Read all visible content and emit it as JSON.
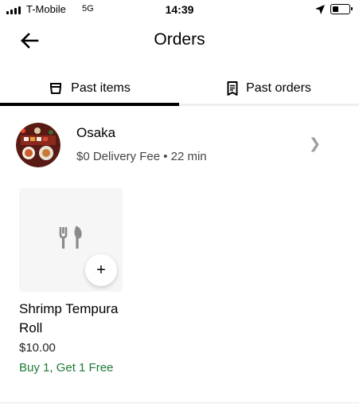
{
  "status_bar": {
    "carrier": "T-Mobile",
    "network": "5G",
    "time": "14:39",
    "battery_level": 0.35,
    "signal_bars": 4
  },
  "header": {
    "title": "Orders",
    "back_icon": "arrow-left-icon"
  },
  "tabs": [
    {
      "label": "Past items",
      "icon": "basket-icon",
      "active": true
    },
    {
      "label": "Past orders",
      "icon": "receipt-icon",
      "active": false
    }
  ],
  "store": {
    "name": "Osaka",
    "meta": "$0 Delivery Fee • 22 min"
  },
  "items": [
    {
      "name": "Shrimp Tempura Roll",
      "price": "$10.00",
      "promo": "Buy 1, Get 1 Free",
      "add_label": "+",
      "placeholder_icon": "utensils-icon"
    }
  ],
  "colors": {
    "promo": "#1f7a37",
    "tab_active": "#000000",
    "placeholder_bg": "#f6f6f6"
  }
}
